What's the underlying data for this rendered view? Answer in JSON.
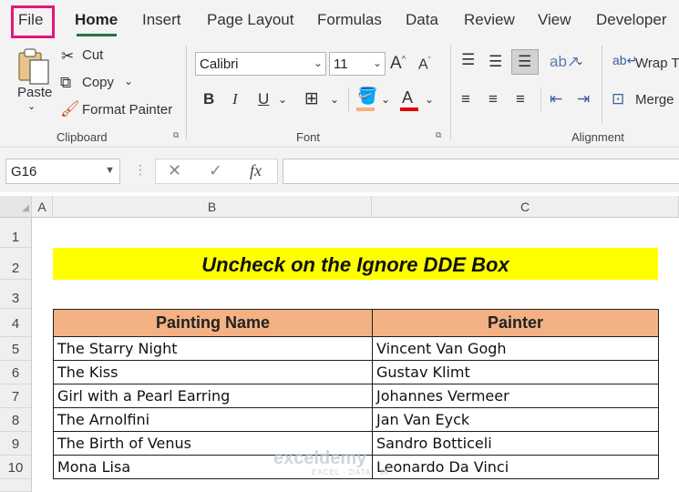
{
  "ribbon_tabs": [
    "File",
    "Home",
    "Insert",
    "Page Layout",
    "Formulas",
    "Data",
    "Review",
    "View",
    "Developer"
  ],
  "clipboard": {
    "paste_label": "Paste",
    "cut_label": "Cut",
    "copy_label": "Copy",
    "format_painter_label": "Format Painter",
    "group_label": "Clipboard"
  },
  "font": {
    "name": "Calibri",
    "size": "11",
    "group_label": "Font",
    "bold": "B",
    "italic": "I",
    "underline": "U",
    "font_color_letter": "A",
    "grow_label": "A",
    "shrink_label": "A"
  },
  "alignment": {
    "wrap_label": "Wrap T",
    "merge_label": "Merge",
    "group_label": "Alignment"
  },
  "formula_bar": {
    "name_box": "G16",
    "fx": "fx",
    "value": ""
  },
  "grid": {
    "columns": [
      "A",
      "B",
      "C"
    ],
    "rows": [
      "1",
      "2",
      "3",
      "4",
      "5",
      "6",
      "7",
      "8",
      "9",
      "10"
    ]
  },
  "sheet": {
    "title": "Uncheck on the Ignore DDE Box",
    "headers": [
      "Painting Name",
      "Painter"
    ],
    "rows": [
      [
        "The Starry Night",
        "Vincent Van Gogh"
      ],
      [
        "The Kiss",
        "Gustav Klimt"
      ],
      [
        "Girl with a Pearl Earring",
        "Johannes Vermeer"
      ],
      [
        "The Arnolfini",
        "Jan Van Eyck"
      ],
      [
        "The Birth of Venus",
        "Sandro Botticeli"
      ],
      [
        "Mona Lisa",
        "Leonardo Da Vinci"
      ]
    ]
  },
  "watermark": {
    "brand": "exceldemy",
    "tagline": "EXCEL · DATA · BI"
  },
  "colors": {
    "accent": "#217346",
    "highlight_border": "#e5157a",
    "title_fill": "#ffff00",
    "header_fill": "#f4b183"
  }
}
